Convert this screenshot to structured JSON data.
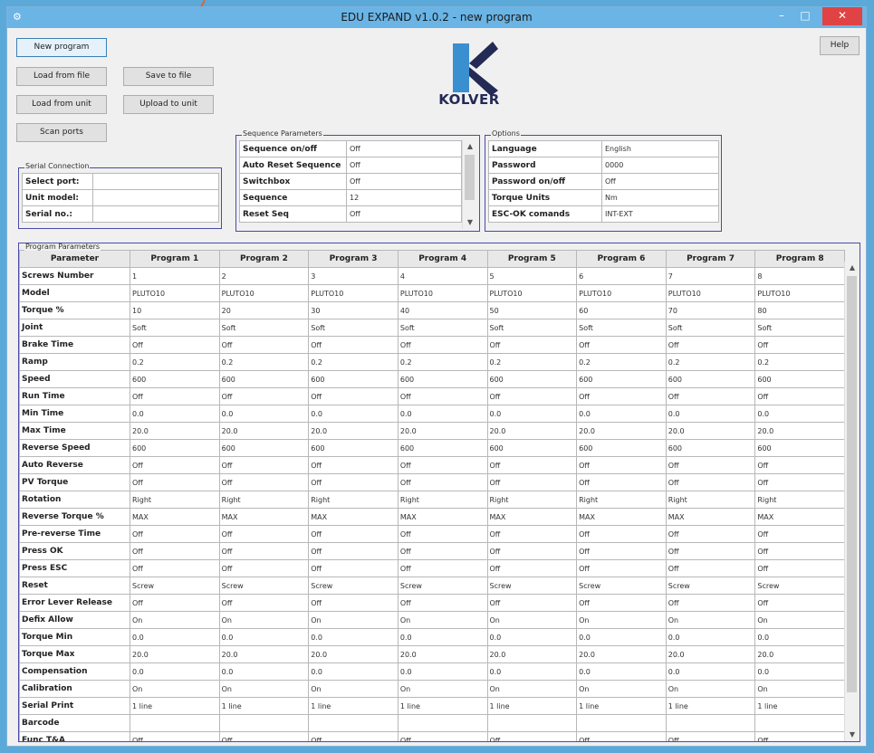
{
  "window": {
    "title": "EDU EXPAND v1.0.2 - new program",
    "min": "–",
    "max": "□",
    "close": "✕",
    "app_icon": "⚙"
  },
  "toolbar": {
    "new_program": "New program",
    "load_from_file": "Load from file",
    "save_to_file": "Save to file",
    "load_from_unit": "Load from unit",
    "upload_to_unit": "Upload to unit",
    "scan_ports": "Scan ports",
    "help": "Help"
  },
  "logo": {
    "text": "KOLVER"
  },
  "serial": {
    "legend": "Serial Connection",
    "rows": [
      {
        "k": "Select port:",
        "v": ""
      },
      {
        "k": "Unit model:",
        "v": ""
      },
      {
        "k": "Serial no.:",
        "v": ""
      }
    ]
  },
  "sequence": {
    "legend": "Sequence Parameters",
    "rows": [
      {
        "k": "Sequence on/off",
        "v": "Off"
      },
      {
        "k": "Auto Reset Sequence",
        "v": "Off"
      },
      {
        "k": "Switchbox",
        "v": "Off"
      },
      {
        "k": "Sequence",
        "v": "12"
      },
      {
        "k": "Reset Seq",
        "v": "Off"
      }
    ]
  },
  "options": {
    "legend": "Options",
    "rows": [
      {
        "k": "Language",
        "v": "English"
      },
      {
        "k": "Password",
        "v": "0000"
      },
      {
        "k": "Password on/off",
        "v": "Off"
      },
      {
        "k": "Torque Units",
        "v": "Nm"
      },
      {
        "k": "ESC-OK comands",
        "v": "INT-EXT"
      }
    ]
  },
  "program": {
    "legend": "Program Parameters",
    "headers": [
      "Parameter",
      "Program 1",
      "Program 2",
      "Program 3",
      "Program 4",
      "Program 5",
      "Program 6",
      "Program 7",
      "Program 8"
    ],
    "rows": [
      [
        "Screws Number",
        "1",
        "2",
        "3",
        "4",
        "5",
        "6",
        "7",
        "8"
      ],
      [
        "Model",
        "PLUTO10",
        "PLUTO10",
        "PLUTO10",
        "PLUTO10",
        "PLUTO10",
        "PLUTO10",
        "PLUTO10",
        "PLUTO10"
      ],
      [
        "Torque %",
        "10",
        "20",
        "30",
        "40",
        "50",
        "60",
        "70",
        "80"
      ],
      [
        "Joint",
        "Soft",
        "Soft",
        "Soft",
        "Soft",
        "Soft",
        "Soft",
        "Soft",
        "Soft"
      ],
      [
        "Brake Time",
        "Off",
        "Off",
        "Off",
        "Off",
        "Off",
        "Off",
        "Off",
        "Off"
      ],
      [
        "Ramp",
        "0.2",
        "0.2",
        "0.2",
        "0.2",
        "0.2",
        "0.2",
        "0.2",
        "0.2"
      ],
      [
        "Speed",
        "600",
        "600",
        "600",
        "600",
        "600",
        "600",
        "600",
        "600"
      ],
      [
        "Run Time",
        "Off",
        "Off",
        "Off",
        "Off",
        "Off",
        "Off",
        "Off",
        "Off"
      ],
      [
        "Min Time",
        "0.0",
        "0.0",
        "0.0",
        "0.0",
        "0.0",
        "0.0",
        "0.0",
        "0.0"
      ],
      [
        "Max Time",
        "20.0",
        "20.0",
        "20.0",
        "20.0",
        "20.0",
        "20.0",
        "20.0",
        "20.0"
      ],
      [
        "Reverse Speed",
        "600",
        "600",
        "600",
        "600",
        "600",
        "600",
        "600",
        "600"
      ],
      [
        "Auto Reverse",
        "Off",
        "Off",
        "Off",
        "Off",
        "Off",
        "Off",
        "Off",
        "Off"
      ],
      [
        "PV Torque",
        "Off",
        "Off",
        "Off",
        "Off",
        "Off",
        "Off",
        "Off",
        "Off"
      ],
      [
        "Rotation",
        "Right",
        "Right",
        "Right",
        "Right",
        "Right",
        "Right",
        "Right",
        "Right"
      ],
      [
        "Reverse Torque %",
        "MAX",
        "MAX",
        "MAX",
        "MAX",
        "MAX",
        "MAX",
        "MAX",
        "MAX"
      ],
      [
        "Pre-reverse Time",
        "Off",
        "Off",
        "Off",
        "Off",
        "Off",
        "Off",
        "Off",
        "Off"
      ],
      [
        "Press OK",
        "Off",
        "Off",
        "Off",
        "Off",
        "Off",
        "Off",
        "Off",
        "Off"
      ],
      [
        "Press ESC",
        "Off",
        "Off",
        "Off",
        "Off",
        "Off",
        "Off",
        "Off",
        "Off"
      ],
      [
        "Reset",
        "Screw",
        "Screw",
        "Screw",
        "Screw",
        "Screw",
        "Screw",
        "Screw",
        "Screw"
      ],
      [
        "Error Lever Release",
        "Off",
        "Off",
        "Off",
        "Off",
        "Off",
        "Off",
        "Off",
        "Off"
      ],
      [
        "Defix Allow",
        "On",
        "On",
        "On",
        "On",
        "On",
        "On",
        "On",
        "On"
      ],
      [
        "Torque Min",
        "0.0",
        "0.0",
        "0.0",
        "0.0",
        "0.0",
        "0.0",
        "0.0",
        "0.0"
      ],
      [
        "Torque Max",
        "20.0",
        "20.0",
        "20.0",
        "20.0",
        "20.0",
        "20.0",
        "20.0",
        "20.0"
      ],
      [
        "Compensation",
        "0.0",
        "0.0",
        "0.0",
        "0.0",
        "0.0",
        "0.0",
        "0.0",
        "0.0"
      ],
      [
        "Calibration",
        "On",
        "On",
        "On",
        "On",
        "On",
        "On",
        "On",
        "On"
      ],
      [
        "Serial Print",
        "1 line",
        "1 line",
        "1 line",
        "1 line",
        "1 line",
        "1 line",
        "1 line",
        "1 line"
      ],
      [
        "Barcode",
        "",
        "",
        "",
        "",
        "",
        "",
        "",
        ""
      ],
      [
        "Func T&A",
        "Off",
        "Off",
        "Off",
        "Off",
        "Off",
        "Off",
        "Off",
        "Off"
      ]
    ]
  },
  "colors": {
    "accent": "#e0632a",
    "titlebar": "#6ab4e6",
    "close": "#e04343",
    "border": "#4a4aa8"
  }
}
